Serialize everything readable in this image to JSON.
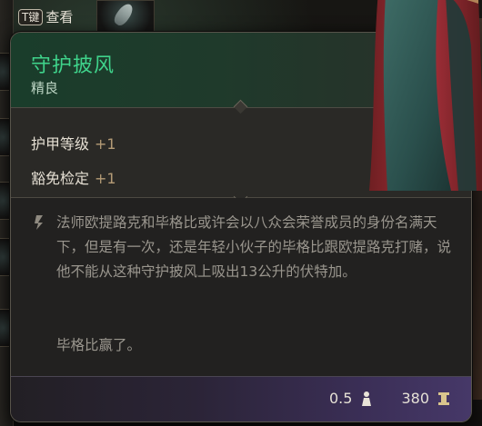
{
  "hint": {
    "key": "T键",
    "label": "查看"
  },
  "item": {
    "name": "守护披风",
    "rarity": "精良",
    "name_color": "#3fd38b"
  },
  "stats": [
    {
      "label": "护甲等级",
      "value": "+1"
    },
    {
      "label": "豁免检定",
      "value": "+1"
    }
  ],
  "description": {
    "body": "法师欧提路克和毕格比或许会以八众会荣誉成员的身份名满天下，但是有一次，还是年轻小伙子的毕格比跟欧提路克打赌，说他不能从这种守护披风上吸出13公升的伏特加。",
    "ending": "毕格比赢了。"
  },
  "footer": {
    "weight": "0.5",
    "weight_icon": "weight-icon",
    "price": "380",
    "price_icon": "gold-coin-icon"
  },
  "icons": {
    "description": "quote-mark-icon",
    "item_art": "cloak-image"
  }
}
